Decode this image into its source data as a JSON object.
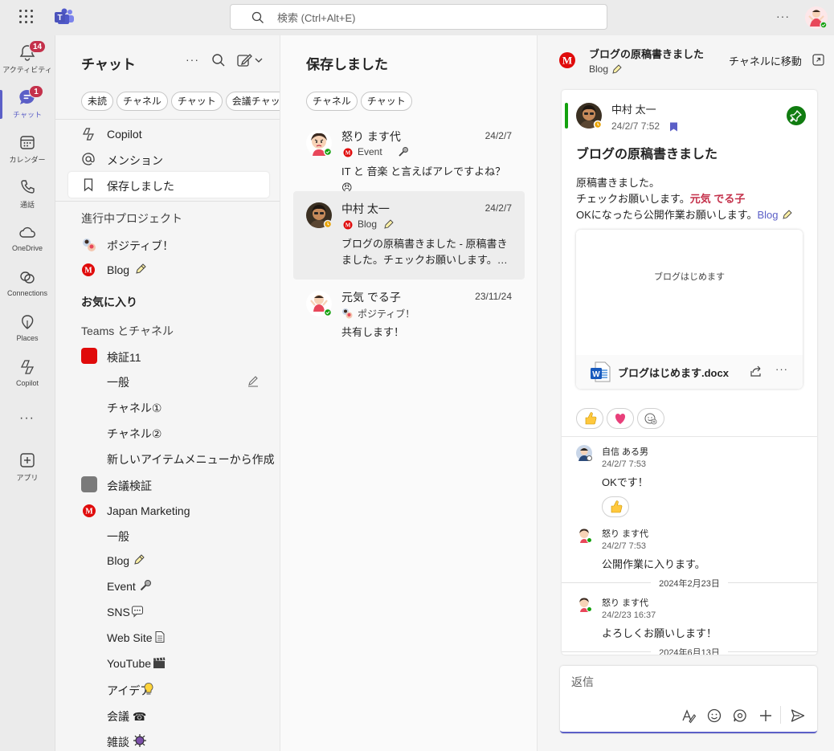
{
  "topbar": {
    "search_placeholder": "検索 (Ctrl+Alt+E)",
    "more": "···"
  },
  "rail": {
    "items": [
      {
        "label": "アクティビティ",
        "badge": "14",
        "icon": "bell-icon"
      },
      {
        "label": "チャット",
        "badge": "1",
        "icon": "chat-icon"
      },
      {
        "label": "カレンダー",
        "icon": "calendar-icon"
      },
      {
        "label": "通話",
        "icon": "phone-icon"
      },
      {
        "label": "OneDrive",
        "icon": "cloud-icon"
      },
      {
        "label": "Connections",
        "icon": "connections-icon"
      },
      {
        "label": "Places",
        "icon": "places-icon"
      },
      {
        "label": "Copilot",
        "icon": "copilot-icon"
      },
      {
        "label": "アプリ",
        "icon": "add-app-icon"
      }
    ],
    "more": "···"
  },
  "chat_panel": {
    "title": "チャット",
    "more": "···",
    "filters": [
      "未読",
      "チャネル",
      "チャット",
      "会議チャット"
    ],
    "nav": [
      {
        "label": "Copilot",
        "icon": "copilot-icon"
      },
      {
        "label": "メンション",
        "icon": "at-icon"
      },
      {
        "label": "保存しました",
        "icon": "bookmark-icon"
      }
    ],
    "in_progress_header": "進行中プロジェクト",
    "in_progress": [
      {
        "label": "ポジティブ！"
      },
      {
        "label": "Blog"
      }
    ],
    "favorites_header": "お気に入り",
    "teams_header": "Teams とチャネル",
    "teams": [
      {
        "name": "検証11",
        "channels": [
          "一般",
          "チャネル①",
          "チャネル②",
          "新しいアイテムメニューから作成"
        ]
      },
      {
        "name": "会議検証",
        "channels": []
      },
      {
        "name": "Japan Marketing",
        "channels": [
          "一般",
          "Blog",
          "Event",
          "SNS",
          "Web Site",
          "YouTube",
          "アイデア",
          "会議 ☎",
          "雑談"
        ]
      }
    ]
  },
  "saved_panel": {
    "title": "保存しました",
    "filters": [
      "チャネル",
      "チャット"
    ],
    "cards": [
      {
        "name": "怒り ます代",
        "date": "24/2/7",
        "source": "Event",
        "message": "IT と 音楽 と言えばアレですよね？😠"
      },
      {
        "name": "中村 太一",
        "date": "24/2/7",
        "source": "Blog",
        "message": "ブログの原稿書きました - 原稿書きました。チェックお願いします。元気 でる子 OKになったら公開作業お願いします。"
      },
      {
        "name": "元気 でる子",
        "date": "23/11/24",
        "source": "ポジティブ！",
        "message": "共有します！"
      }
    ]
  },
  "thread": {
    "title": "ブログの原稿書きました",
    "channel": "Blog",
    "goto_label": "チャネルに移動",
    "post": {
      "author": "中村 太一",
      "time": "24/2/7 7:52",
      "subject": "ブログの原稿書きました",
      "line1": "原稿書きました。",
      "line2_prefix": "チェックお願いします。",
      "mention": "元気 でる子",
      "line3_prefix": "OKになったら公開作業お願いします。",
      "channel_mention": "Blog",
      "attachment_preview": "ブログはじめます",
      "attachment_name": "ブログはじめます.docx",
      "attachment_more": "···"
    },
    "replies": [
      {
        "author": "自信 ある男",
        "time": "24/2/7 7:53",
        "text": "OKです！"
      },
      {
        "author": "怒り ます代",
        "time": "24/2/7 7:53",
        "text": "公開作業に入ります。"
      },
      {
        "author": "怒り ます代",
        "time": "24/2/23 16:37",
        "text": "よろしくお願いします！"
      }
    ],
    "date_separators": [
      "2024年2月23日",
      "2024年6月13日"
    ],
    "composer_placeholder": "返信"
  },
  "colors": {
    "accent": "#5b5fc7",
    "badge": "#c4314b",
    "pin": "#107c10",
    "mention": "#c4314b"
  }
}
